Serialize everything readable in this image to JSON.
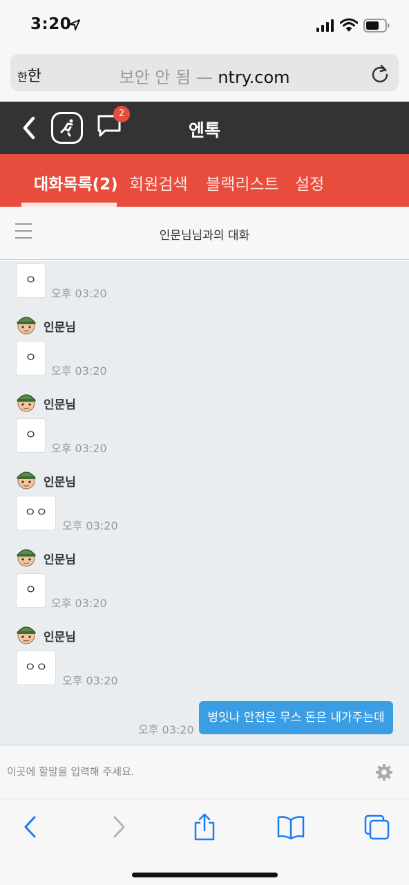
{
  "status_bar": {
    "time": "3:20"
  },
  "browser": {
    "reader_label_small": "한",
    "reader_label_large": "한",
    "insecure_label": "보안 안 됨 —",
    "domain": "ntry.com"
  },
  "header": {
    "title": "엔톡",
    "chat_badge_count": "2"
  },
  "tabs": [
    {
      "label": "대화목록(2)",
      "active": true
    },
    {
      "label": "회원검색",
      "active": false
    },
    {
      "label": "블랙리스트",
      "active": false
    },
    {
      "label": "설정",
      "active": false
    }
  ],
  "chat": {
    "title": "인문님님과의 대화",
    "messages": [
      {
        "sender": "",
        "text": "ㅇ",
        "time": "오후 03:20"
      },
      {
        "sender": "인문님",
        "text": "ㅇ",
        "time": "오후 03:20"
      },
      {
        "sender": "인문님",
        "text": "ㅇ",
        "time": "오후 03:20"
      },
      {
        "sender": "인문님",
        "text": "ㅇㅇ",
        "time": "오후 03:20"
      },
      {
        "sender": "인문님",
        "text": "ㅇ",
        "time": "오후 03:20"
      },
      {
        "sender": "인문님",
        "text": "ㅇㅇ",
        "time": "오후 03:20"
      }
    ],
    "my_message": {
      "text": "병잇나 안전은 무스 돈은 내가주는데",
      "time": "오후 03:20"
    }
  },
  "input": {
    "placeholder": "이곳에 할말을 입력해 주세요."
  },
  "colors": {
    "header_bg": "#333333",
    "tab_bg": "#e74c3c",
    "my_bubble": "#3b9de3",
    "ios_blue": "#1a7cf0"
  }
}
